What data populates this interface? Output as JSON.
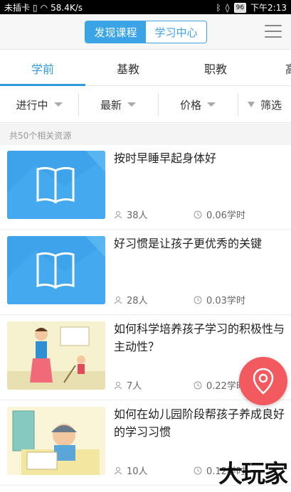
{
  "status_bar": {
    "carrier": "未插卡",
    "speed": "58.4K/s",
    "battery": "96",
    "time": "下午2:13"
  },
  "header": {
    "segments": [
      "发现课程",
      "学习中心"
    ],
    "active_segment": 0
  },
  "tabs": {
    "items": [
      "学前",
      "基教",
      "职教",
      "高"
    ],
    "active": 0
  },
  "filters": {
    "status": "进行中",
    "sort": "最新",
    "price": "价格",
    "filter": "筛选"
  },
  "result_count": "共50个相关资源",
  "courses": [
    {
      "title": "按时早睡早起身体好",
      "people": "38人",
      "hours": "0.06学时",
      "thumb": "book-icon"
    },
    {
      "title": "好习惯是让孩子更优秀的关键",
      "people": "28人",
      "hours": "0.03学时",
      "thumb": "book-icon"
    },
    {
      "title": "如何科学培养孩子学习的积极性与主动性？",
      "people": "7人",
      "hours": "0.22学时",
      "thumb": "illustration-teacher-child"
    },
    {
      "title": "如何在幼儿园阶段帮孩子养成良好的学习习惯",
      "people": "10人",
      "hours": "0.12学时",
      "thumb": "illustration-child-writing"
    }
  ],
  "watermark": "大玩家",
  "colors": {
    "accent": "#2f9ae0",
    "fab": "#f25a5f"
  }
}
